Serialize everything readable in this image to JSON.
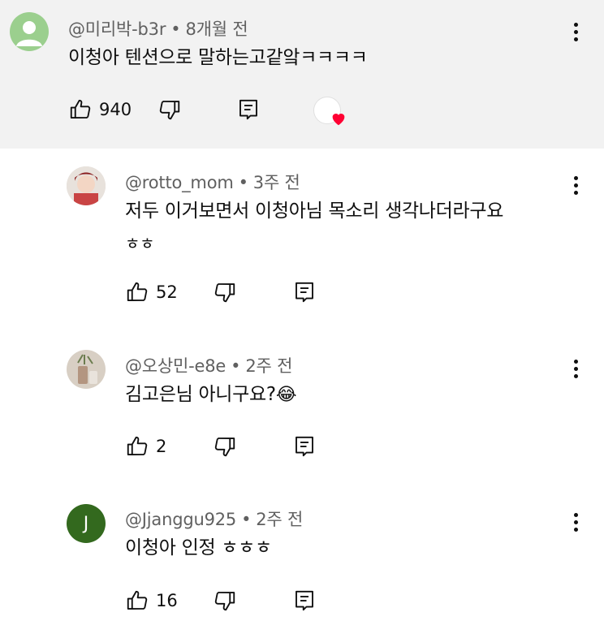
{
  "comments": [
    {
      "handle": "@미리박-b3r",
      "time": "8개월 전",
      "text": "이청아 텐션으로 말하는고같앜ㅋㅋㅋㅋ",
      "likes": "940",
      "avatar_color": "#9bcf8e"
    },
    {
      "handle": "@rotto_mom",
      "time": "3주 전",
      "text_line1": "저두 이거보면서 이청아님 목소리 생각나더라구요",
      "text_line2": "ㅎㅎ",
      "likes": "52"
    },
    {
      "handle": "@오상민-e8e",
      "time": "2주 전",
      "text": "김고은님 아니구요?",
      "emoji": "😂",
      "likes": "2"
    },
    {
      "handle": "@Jjanggu925",
      "time": "2주 전",
      "text": "이청아 인정 ㅎㅎㅎ",
      "likes": "16",
      "avatar_letter": "J",
      "avatar_color": "#33691e"
    }
  ],
  "icons": {
    "like": "thumbs-up-icon",
    "dislike": "thumbs-down-icon",
    "reply": "reply-icon",
    "menu": "more-vert-icon",
    "heart": "creator-heart-icon"
  },
  "colors": {
    "heart": "#ff0033",
    "highlight_bg": "#f2f2f2",
    "meta_text": "#606060"
  }
}
